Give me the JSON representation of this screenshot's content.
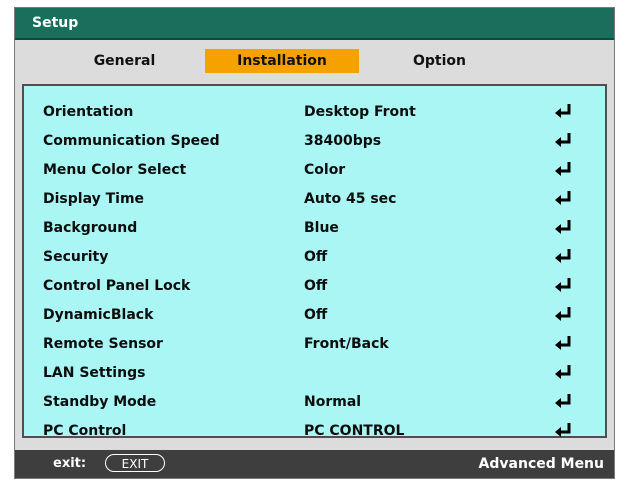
{
  "window": {
    "title": "Setup"
  },
  "tabs": [
    {
      "label": "General",
      "active": false
    },
    {
      "label": "Installation",
      "active": true
    },
    {
      "label": "Option",
      "active": false
    }
  ],
  "settings": [
    {
      "label": "Orientation",
      "value": "Desktop Front"
    },
    {
      "label": "Communication Speed",
      "value": "38400bps"
    },
    {
      "label": "Menu Color Select",
      "value": "Color"
    },
    {
      "label": "Display Time",
      "value": "Auto 45 sec"
    },
    {
      "label": "Background",
      "value": "Blue"
    },
    {
      "label": "Security",
      "value": "Off"
    },
    {
      "label": "Control Panel Lock",
      "value": "Off"
    },
    {
      "label": "DynamicBlack",
      "value": "Off"
    },
    {
      "label": "Remote Sensor",
      "value": "Front/Back"
    },
    {
      "label": "LAN Settings",
      "value": ""
    },
    {
      "label": "Standby Mode",
      "value": "Normal"
    },
    {
      "label": "PC Control",
      "value": "PC CONTROL"
    }
  ],
  "footer": {
    "exit_label": "exit:",
    "exit_key": "EXIT",
    "advanced": "Advanced Menu"
  },
  "colors": {
    "title_bar": "#1a6f5c",
    "active_tab": "#f5a100",
    "panel_bg": "#a9f6f4",
    "footer_bg": "#3e3e3e"
  },
  "icons": {
    "enter": "enter-arrow-icon"
  }
}
